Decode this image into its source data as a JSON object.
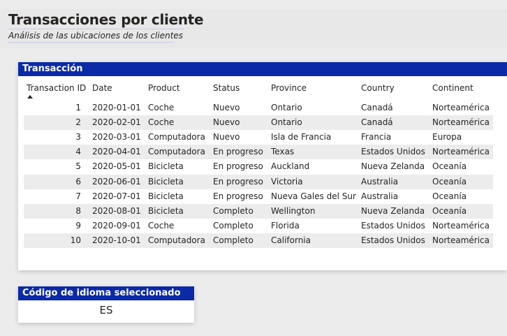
{
  "header": {
    "title": "Transacciones por cliente",
    "subtitle": "Análisis de las ubicaciones de los clientes"
  },
  "table_card": {
    "title": "Transacción",
    "columns": [
      "Transaction ID",
      "Date",
      "Product",
      "Status",
      "Province",
      "Country",
      "Continent"
    ],
    "sorted_column": "Transaction ID",
    "sort_direction": "ascending",
    "rows": [
      [
        "1",
        "2020-01-01",
        "Coche",
        "Nuevo",
        "Ontario",
        "Canadá",
        "Norteamérica"
      ],
      [
        "2",
        "2020-02-01",
        "Coche",
        "Nuevo",
        "Ontario",
        "Canadá",
        "Norteamérica"
      ],
      [
        "3",
        "2020-03-01",
        "Computadora",
        "Nuevo",
        "Isla de Francia",
        "Francia",
        "Europa"
      ],
      [
        "4",
        "2020-04-01",
        "Computadora",
        "En progreso",
        "Texas",
        "Estados Unidos",
        "Norteamérica"
      ],
      [
        "5",
        "2020-05-01",
        "Bicicleta",
        "En progreso",
        "Auckland",
        "Nueva Zelanda",
        "Oceanía"
      ],
      [
        "6",
        "2020-06-01",
        "Bicicleta",
        "En progreso",
        "Victoria",
        "Australia",
        "Oceanía"
      ],
      [
        "7",
        "2020-07-01",
        "Bicicleta",
        "En progreso",
        "Nueva Gales del Sur",
        "Australia",
        "Oceanía"
      ],
      [
        "8",
        "2020-08-01",
        "Bicicleta",
        "Completo",
        "Wellington",
        "Nueva Zelanda",
        "Oceanía"
      ],
      [
        "9",
        "2020-09-01",
        "Coche",
        "Completo",
        "Florida",
        "Estados Unidos",
        "Norteamérica"
      ],
      [
        "10",
        "2020-10-01",
        "Computadora",
        "Completo",
        "California",
        "Estados Unidos",
        "Norteamérica"
      ]
    ]
  },
  "language_card": {
    "title": "Código de idioma seleccionado",
    "value": "ES"
  },
  "colors": {
    "title_bar": "#0a2aa8",
    "row_alt": "#ececec",
    "background": "#ececec"
  }
}
